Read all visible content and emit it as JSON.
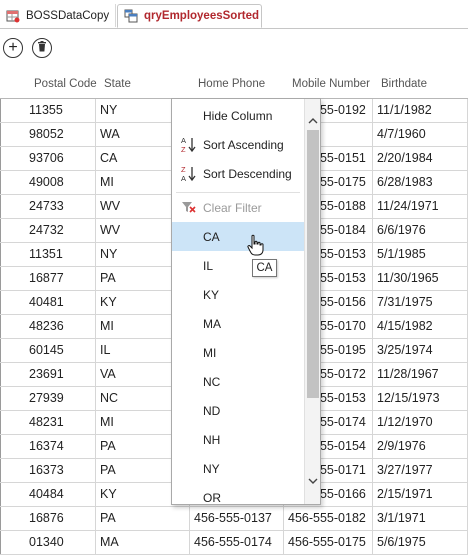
{
  "tabs": [
    {
      "label": "BOSSDataCopy",
      "icon": "table-icon"
    },
    {
      "label": "qryEmployeesSorted",
      "icon": "query-icon"
    }
  ],
  "toolbar": {
    "add_label": "+",
    "delete_icon": "trash-icon"
  },
  "columns": [
    "Postal Code",
    "State",
    "Home Phone",
    "Mobile Number",
    "Birthdate"
  ],
  "rows": [
    {
      "postal": "11355",
      "state": "NY",
      "home": "",
      "mobile": "456-555-0192",
      "birth": "11/1/1982"
    },
    {
      "postal": "98052",
      "state": "WA",
      "home": "",
      "mobile": "",
      "birth": "4/7/1960"
    },
    {
      "postal": "93706",
      "state": "CA",
      "home": "",
      "mobile": "456-555-0151",
      "birth": "2/20/1984"
    },
    {
      "postal": "49008",
      "state": "MI",
      "home": "",
      "mobile": "456-555-0175",
      "birth": "6/28/1983"
    },
    {
      "postal": "24733",
      "state": "WV",
      "home": "",
      "mobile": "456-555-0188",
      "birth": "11/24/1971"
    },
    {
      "postal": "24732",
      "state": "WV",
      "home": "",
      "mobile": "456-555-0184",
      "birth": "6/6/1976"
    },
    {
      "postal": "11351",
      "state": "NY",
      "home": "",
      "mobile": "456-555-0153",
      "birth": "5/1/1985"
    },
    {
      "postal": "16877",
      "state": "PA",
      "home": "",
      "mobile": "456-555-0153",
      "birth": "11/30/1965"
    },
    {
      "postal": "40481",
      "state": "KY",
      "home": "",
      "mobile": "456-555-0156",
      "birth": "7/31/1975"
    },
    {
      "postal": "48236",
      "state": "MI",
      "home": "",
      "mobile": "456-555-0170",
      "birth": "4/15/1982"
    },
    {
      "postal": "60145",
      "state": "IL",
      "home": "",
      "mobile": "456-555-0195",
      "birth": "3/25/1974"
    },
    {
      "postal": "23691",
      "state": "VA",
      "home": "",
      "mobile": "456-555-0172",
      "birth": "11/28/1967"
    },
    {
      "postal": "27939",
      "state": "NC",
      "home": "",
      "mobile": "456-555-0153",
      "birth": "12/15/1973"
    },
    {
      "postal": "48231",
      "state": "MI",
      "home": "",
      "mobile": "456-555-0174",
      "birth": "1/12/1970"
    },
    {
      "postal": "16374",
      "state": "PA",
      "home": "",
      "mobile": "456-555-0154",
      "birth": "2/9/1976"
    },
    {
      "postal": "16373",
      "state": "PA",
      "home": "",
      "mobile": "456-555-0171",
      "birth": "3/27/1977"
    },
    {
      "postal": "40484",
      "state": "KY",
      "home": "",
      "mobile": "456-555-0166",
      "birth": "2/15/1971"
    },
    {
      "postal": "16876",
      "state": "PA",
      "home": "456-555-0137",
      "mobile": "456-555-0182",
      "birth": "3/1/1971"
    },
    {
      "postal": "01340",
      "state": "MA",
      "home": "456-555-0174",
      "mobile": "456-555-0175",
      "birth": "5/6/1975"
    }
  ],
  "menu": {
    "hide_column": "Hide Column",
    "sort_ascending": "Sort Ascending",
    "sort_descending": "Sort Descending",
    "clear_filter": "Clear Filter",
    "values": [
      "CA",
      "IL",
      "KY",
      "MA",
      "MI",
      "NC",
      "ND",
      "NH",
      "NY",
      "OR"
    ],
    "selected": "CA"
  },
  "tooltip": "CA",
  "colors": {
    "active_tab_text": "#b1282e",
    "selected_item": "#cce4f7"
  }
}
